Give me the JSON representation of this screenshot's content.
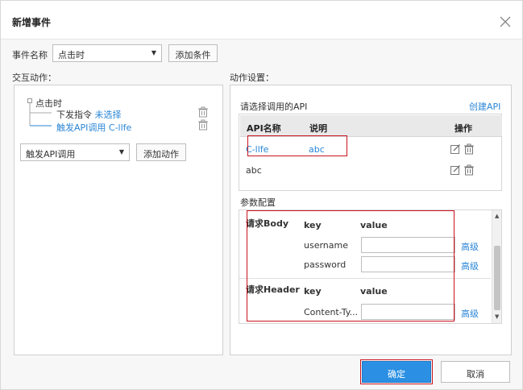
{
  "dialog": {
    "title": "新增事件"
  },
  "event_name": {
    "label": "事件名称",
    "value": "点击时",
    "add_condition_label": "添加条件"
  },
  "interaction": {
    "label": "交互动作：",
    "tree": {
      "root": "点击时",
      "children": [
        {
          "prefix": "下发指令",
          "value": "未选择"
        },
        {
          "prefix": "触发API调用",
          "value": "C-llfe"
        }
      ]
    },
    "action_select": "触发API调用",
    "add_action_label": "添加动作"
  },
  "settings": {
    "label": "动作设置：",
    "api_panel": {
      "label": "请选择调用的API",
      "create_label": "创建API",
      "columns": [
        "API名称",
        "说明",
        "操作"
      ],
      "rows": [
        {
          "name": "C-llfe",
          "desc": "abc"
        },
        {
          "name": "abc",
          "desc": ""
        }
      ]
    },
    "params": {
      "label": "参数配置",
      "sections": [
        {
          "title": "请求Body",
          "key_header": "key",
          "value_header": "value",
          "rows": [
            {
              "key": "username",
              "value": "",
              "advanced": "高级"
            },
            {
              "key": "password",
              "value": "",
              "advanced": "高级"
            }
          ]
        },
        {
          "title": "请求Header",
          "key_header": "key",
          "value_header": "value",
          "rows": [
            {
              "key": "Content-Ty...",
              "value": "",
              "advanced": "高级"
            }
          ]
        }
      ]
    }
  },
  "footer": {
    "confirm_label": "确定",
    "cancel_label": "取消"
  },
  "colors": {
    "link": "#2a86d6",
    "primary": "#2b90e3",
    "highlight": "#c8141e"
  },
  "icons": [
    "close-icon",
    "trash-icon",
    "edit-icon",
    "scroll-up-icon",
    "scroll-down-icon",
    "caret-down-icon"
  ]
}
